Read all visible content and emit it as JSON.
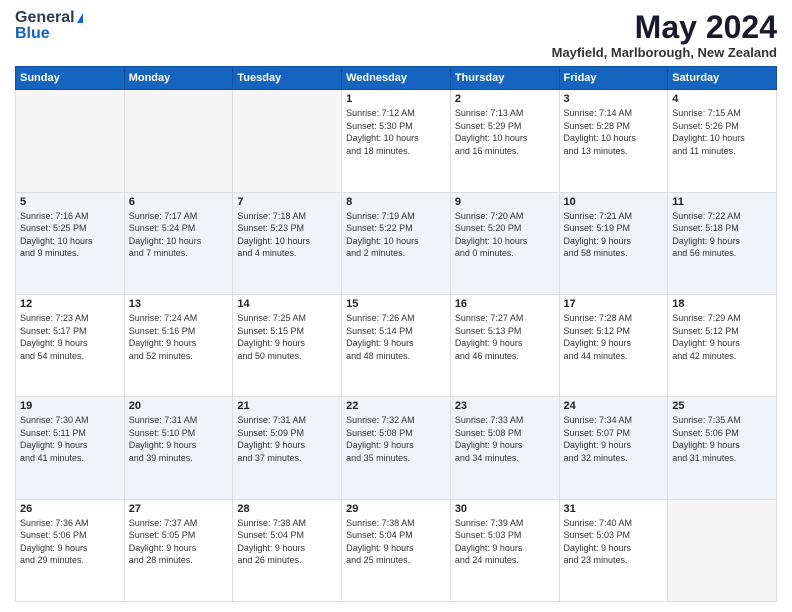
{
  "header": {
    "logo_general": "General",
    "logo_blue": "Blue",
    "month_title": "May 2024",
    "location": "Mayfield, Marlborough, New Zealand"
  },
  "calendar": {
    "days_of_week": [
      "Sunday",
      "Monday",
      "Tuesday",
      "Wednesday",
      "Thursday",
      "Friday",
      "Saturday"
    ],
    "weeks": [
      [
        {
          "day": "",
          "info": ""
        },
        {
          "day": "",
          "info": ""
        },
        {
          "day": "",
          "info": ""
        },
        {
          "day": "1",
          "info": "Sunrise: 7:12 AM\nSunset: 5:30 PM\nDaylight: 10 hours\nand 18 minutes."
        },
        {
          "day": "2",
          "info": "Sunrise: 7:13 AM\nSunset: 5:29 PM\nDaylight: 10 hours\nand 16 minutes."
        },
        {
          "day": "3",
          "info": "Sunrise: 7:14 AM\nSunset: 5:28 PM\nDaylight: 10 hours\nand 13 minutes."
        },
        {
          "day": "4",
          "info": "Sunrise: 7:15 AM\nSunset: 5:26 PM\nDaylight: 10 hours\nand 11 minutes."
        }
      ],
      [
        {
          "day": "5",
          "info": "Sunrise: 7:16 AM\nSunset: 5:25 PM\nDaylight: 10 hours\nand 9 minutes."
        },
        {
          "day": "6",
          "info": "Sunrise: 7:17 AM\nSunset: 5:24 PM\nDaylight: 10 hours\nand 7 minutes."
        },
        {
          "day": "7",
          "info": "Sunrise: 7:18 AM\nSunset: 5:23 PM\nDaylight: 10 hours\nand 4 minutes."
        },
        {
          "day": "8",
          "info": "Sunrise: 7:19 AM\nSunset: 5:22 PM\nDaylight: 10 hours\nand 2 minutes."
        },
        {
          "day": "9",
          "info": "Sunrise: 7:20 AM\nSunset: 5:20 PM\nDaylight: 10 hours\nand 0 minutes."
        },
        {
          "day": "10",
          "info": "Sunrise: 7:21 AM\nSunset: 5:19 PM\nDaylight: 9 hours\nand 58 minutes."
        },
        {
          "day": "11",
          "info": "Sunrise: 7:22 AM\nSunset: 5:18 PM\nDaylight: 9 hours\nand 56 minutes."
        }
      ],
      [
        {
          "day": "12",
          "info": "Sunrise: 7:23 AM\nSunset: 5:17 PM\nDaylight: 9 hours\nand 54 minutes."
        },
        {
          "day": "13",
          "info": "Sunrise: 7:24 AM\nSunset: 5:16 PM\nDaylight: 9 hours\nand 52 minutes."
        },
        {
          "day": "14",
          "info": "Sunrise: 7:25 AM\nSunset: 5:15 PM\nDaylight: 9 hours\nand 50 minutes."
        },
        {
          "day": "15",
          "info": "Sunrise: 7:26 AM\nSunset: 5:14 PM\nDaylight: 9 hours\nand 48 minutes."
        },
        {
          "day": "16",
          "info": "Sunrise: 7:27 AM\nSunset: 5:13 PM\nDaylight: 9 hours\nand 46 minutes."
        },
        {
          "day": "17",
          "info": "Sunrise: 7:28 AM\nSunset: 5:12 PM\nDaylight: 9 hours\nand 44 minutes."
        },
        {
          "day": "18",
          "info": "Sunrise: 7:29 AM\nSunset: 5:12 PM\nDaylight: 9 hours\nand 42 minutes."
        }
      ],
      [
        {
          "day": "19",
          "info": "Sunrise: 7:30 AM\nSunset: 5:11 PM\nDaylight: 9 hours\nand 41 minutes."
        },
        {
          "day": "20",
          "info": "Sunrise: 7:31 AM\nSunset: 5:10 PM\nDaylight: 9 hours\nand 39 minutes."
        },
        {
          "day": "21",
          "info": "Sunrise: 7:31 AM\nSunset: 5:09 PM\nDaylight: 9 hours\nand 37 minutes."
        },
        {
          "day": "22",
          "info": "Sunrise: 7:32 AM\nSunset: 5:08 PM\nDaylight: 9 hours\nand 35 minutes."
        },
        {
          "day": "23",
          "info": "Sunrise: 7:33 AM\nSunset: 5:08 PM\nDaylight: 9 hours\nand 34 minutes."
        },
        {
          "day": "24",
          "info": "Sunrise: 7:34 AM\nSunset: 5:07 PM\nDaylight: 9 hours\nand 32 minutes."
        },
        {
          "day": "25",
          "info": "Sunrise: 7:35 AM\nSunset: 5:06 PM\nDaylight: 9 hours\nand 31 minutes."
        }
      ],
      [
        {
          "day": "26",
          "info": "Sunrise: 7:36 AM\nSunset: 5:06 PM\nDaylight: 9 hours\nand 29 minutes."
        },
        {
          "day": "27",
          "info": "Sunrise: 7:37 AM\nSunset: 5:05 PM\nDaylight: 9 hours\nand 28 minutes."
        },
        {
          "day": "28",
          "info": "Sunrise: 7:38 AM\nSunset: 5:04 PM\nDaylight: 9 hours\nand 26 minutes."
        },
        {
          "day": "29",
          "info": "Sunrise: 7:38 AM\nSunset: 5:04 PM\nDaylight: 9 hours\nand 25 minutes."
        },
        {
          "day": "30",
          "info": "Sunrise: 7:39 AM\nSunset: 5:03 PM\nDaylight: 9 hours\nand 24 minutes."
        },
        {
          "day": "31",
          "info": "Sunrise: 7:40 AM\nSunset: 5:03 PM\nDaylight: 9 hours\nand 23 minutes."
        },
        {
          "day": "",
          "info": ""
        }
      ]
    ]
  }
}
